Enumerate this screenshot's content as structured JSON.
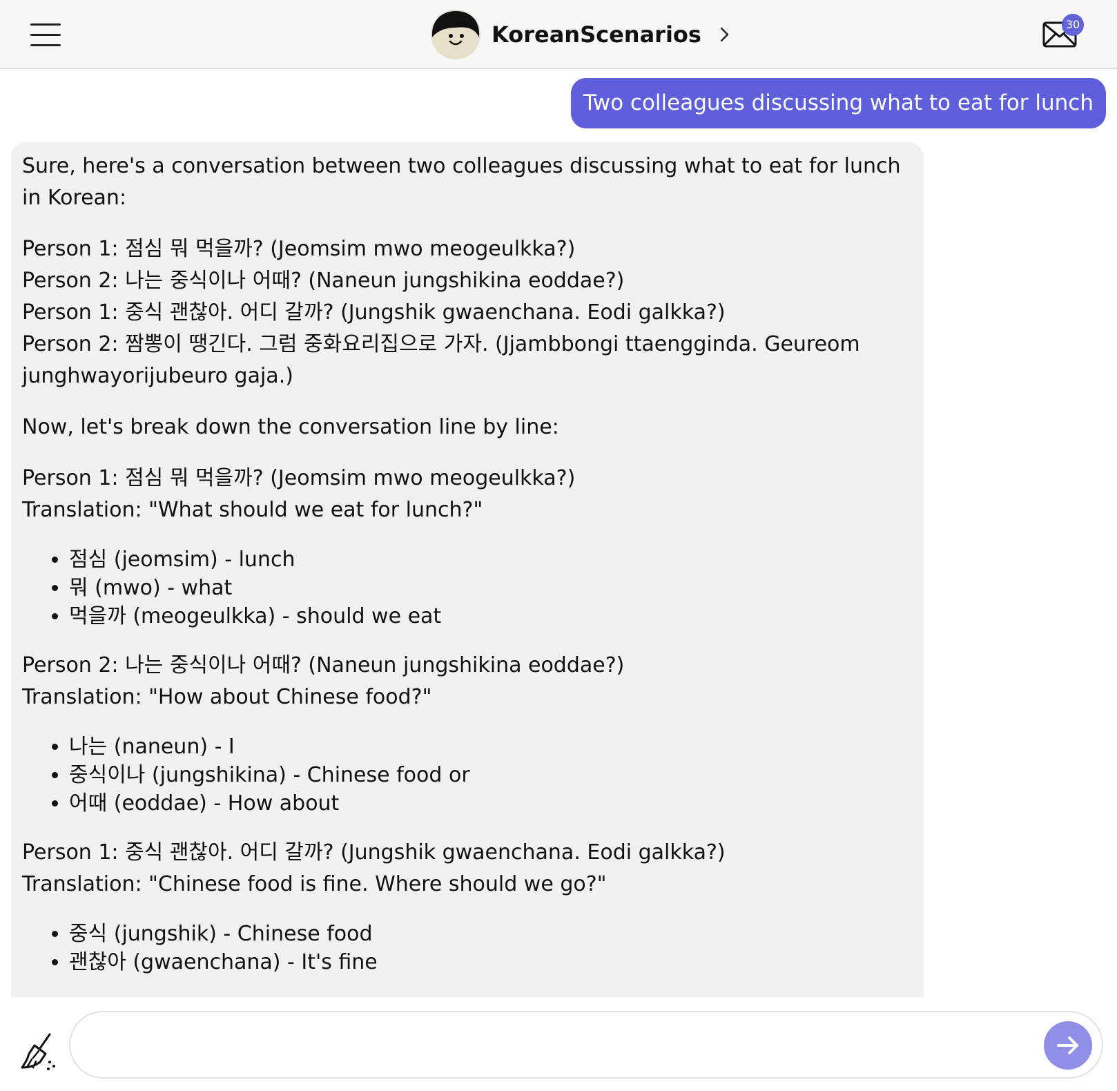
{
  "header": {
    "menu_icon": "hamburger-menu-icon",
    "avatar_icon": "avatar-face-icon",
    "title": "KoreanScenarios",
    "chevron_icon": "chevron-right-icon",
    "mail_icon": "envelope-icon",
    "mail_badge": "30"
  },
  "chat": {
    "user_message": "Two colleagues discussing what to eat for lunch",
    "bot_message": {
      "intro": "Sure, here's a conversation between two colleagues discussing what to eat for lunch in Korean:",
      "dialogue": [
        "Person 1: 점심 뭐 먹을까? (Jeomsim mwo meogeulkka?)",
        "Person 2: 나는 중식이나 어때? (Naneun jungshikina eoddae?)",
        "Person 1: 중식 괜찮아. 어디 갈까? (Jungshik gwaenchana. Eodi galkka?)",
        "Person 2: 짬뽕이 땡긴다. 그럼 중화요리집으로 가자. (Jjambbongi ttaengginda. Geureom junghwayorijubeuro gaja.)"
      ],
      "breakdown_intro": "Now, let's break down the conversation line by line:",
      "breakdown": [
        {
          "line": "Person 1: 점심 뭐 먹을까? (Jeomsim mwo meogeulkka?)",
          "translation": "Translation: \"What should we eat for lunch?\"",
          "vocab": [
            "점심 (jeomsim) - lunch",
            "뭐 (mwo) - what",
            "먹을까 (meogeulkka) - should we eat"
          ]
        },
        {
          "line": "Person 2: 나는 중식이나 어때? (Naneun jungshikina eoddae?)",
          "translation": "Translation: \"How about Chinese food?\"",
          "vocab": [
            "나는 (naneun) - I",
            "중식이나 (jungshikina) - Chinese food or",
            "어때 (eoddae) - How about"
          ]
        },
        {
          "line": "Person 1: 중식 괜찮아. 어디 갈까? (Jungshik gwaenchana. Eodi galkka?)",
          "translation": "Translation: \"Chinese food is fine. Where should we go?\"",
          "vocab": [
            "중식 (jungshik) - Chinese food",
            "괜찮아 (gwaenchana) - It's fine"
          ]
        }
      ]
    }
  },
  "composer": {
    "clear_icon": "broom-icon",
    "input_value": "",
    "input_placeholder": "",
    "send_icon": "arrow-right-icon"
  },
  "colors": {
    "accent": "#5f5fdc",
    "send_button": "#8f8fe8",
    "bot_bubble": "#f1f1f1",
    "header_bg": "#f7f7f7"
  }
}
